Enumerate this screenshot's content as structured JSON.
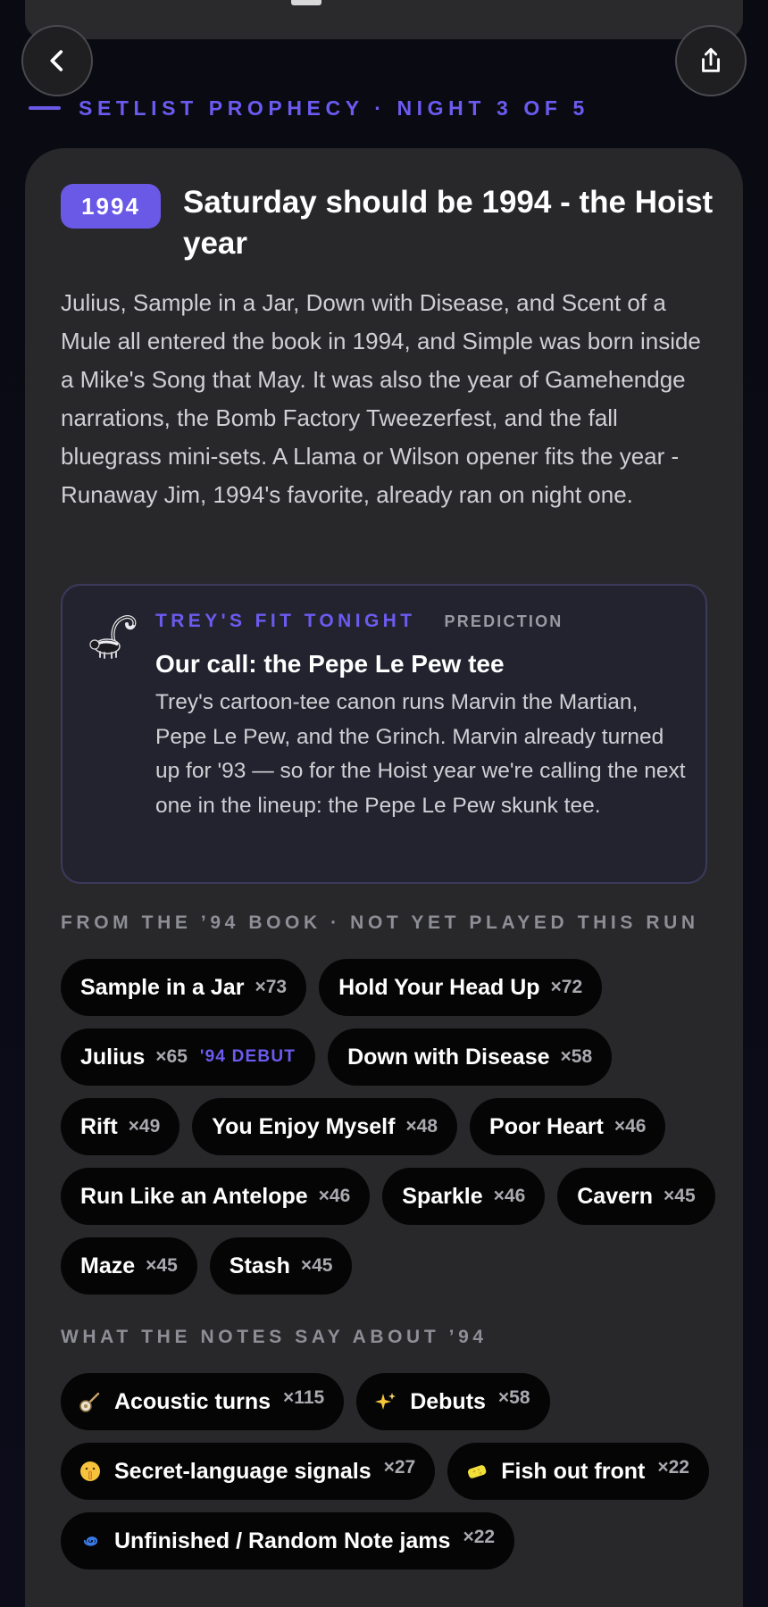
{
  "header": {
    "eyebrow": "SETLIST PROPHECY · NIGHT 3 OF 5"
  },
  "hero": {
    "year_badge": "1994",
    "headline": "Saturday should be 1994 - the Hoist year",
    "summary": "Julius, Sample in a Jar, Down with Disease, and Scent of a Mule all entered the book in 1994, and Simple was born inside a Mike's Song that May. It was also the year of Gamehendge narrations, the Bomb Factory Tweezerfest, and the fall bluegrass mini-sets. A Llama or Wilson opener fits the year - Runaway Jim, 1994's favorite, already ran on night one."
  },
  "fit": {
    "eyebrow": "TREY'S FIT TONIGHT",
    "tag": "PREDICTION",
    "title": "Our call: the Pepe Le Pew tee",
    "body": "Trey's cartoon-tee canon runs Marvin the Martian, Pepe Le Pew, and the Grinch. Marvin already turned up for '93 — so for the Hoist year we're calling the next one in the lineup: the Pepe Le Pew skunk tee.",
    "icon": "skunk-icon"
  },
  "book": {
    "label": "FROM THE ’94 BOOK · NOT YET PLAYED THIS RUN",
    "songs": [
      {
        "name": "Sample in a Jar",
        "count": "×73"
      },
      {
        "name": "Hold Your Head Up",
        "count": "×72"
      },
      {
        "name": "Julius",
        "count": "×65",
        "debut": "'94 DEBUT"
      },
      {
        "name": "Down with Disease",
        "count": "×58"
      },
      {
        "name": "Rift",
        "count": "×49"
      },
      {
        "name": "You Enjoy Myself",
        "count": "×48"
      },
      {
        "name": "Poor Heart",
        "count": "×46"
      },
      {
        "name": "Run Like an Antelope",
        "count": "×46"
      },
      {
        "name": "Sparkle",
        "count": "×46"
      },
      {
        "name": "Cavern",
        "count": "×45"
      },
      {
        "name": "Maze",
        "count": "×45"
      },
      {
        "name": "Stash",
        "count": "×45"
      }
    ]
  },
  "notes": {
    "label": "WHAT THE NOTES SAY ABOUT ’94",
    "items": [
      {
        "icon": "banjo-icon",
        "name": "Acoustic turns",
        "count": "×115"
      },
      {
        "icon": "sparkles-icon",
        "name": "Debuts",
        "count": "×58"
      },
      {
        "icon": "shushing-face-icon",
        "name": "Secret-language signals",
        "count": "×27"
      },
      {
        "icon": "sponge-icon",
        "name": "Fish out front",
        "count": "×22"
      },
      {
        "icon": "vortex-icon",
        "name": "Unfinished / Random Note jams",
        "count": "×22"
      }
    ]
  },
  "colors": {
    "accent": "#6a58e6",
    "card": "#28282b",
    "chip": "#050505"
  }
}
